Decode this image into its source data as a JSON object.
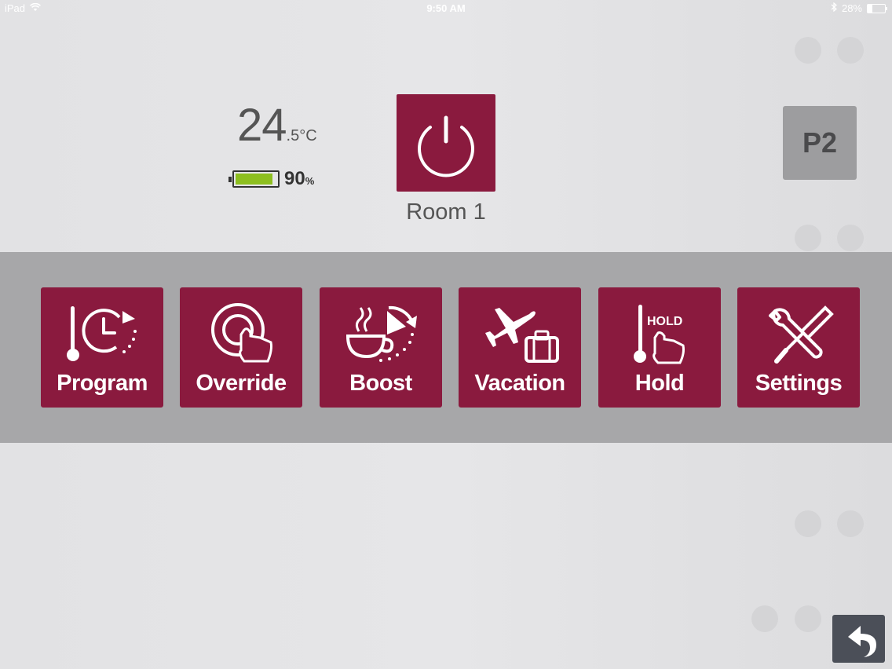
{
  "status_bar": {
    "device": "iPad",
    "time": "9:50 AM",
    "battery_text": "28%",
    "battery_level": 0.28
  },
  "thermostat": {
    "temp_whole": "24",
    "temp_fraction": ".5°C",
    "battery_value": "90",
    "battery_unit": "%",
    "battery_level": 0.9,
    "room_name": "Room 1",
    "profile_label": "P2"
  },
  "actions": [
    {
      "label": "Program",
      "icon": "program-icon"
    },
    {
      "label": "Override",
      "icon": "override-icon"
    },
    {
      "label": "Boost",
      "icon": "boost-icon"
    },
    {
      "label": "Vacation",
      "icon": "vacation-icon"
    },
    {
      "label": "Hold",
      "icon": "hold-icon",
      "icon_text": "HOLD"
    },
    {
      "label": "Settings",
      "icon": "settings-icon"
    }
  ],
  "colors": {
    "accent": "#8a1a3e",
    "band": "#a7a7a9",
    "background": "#e4e4e6",
    "battery_green": "#8dbf1f",
    "back_button": "#4b4f58"
  }
}
